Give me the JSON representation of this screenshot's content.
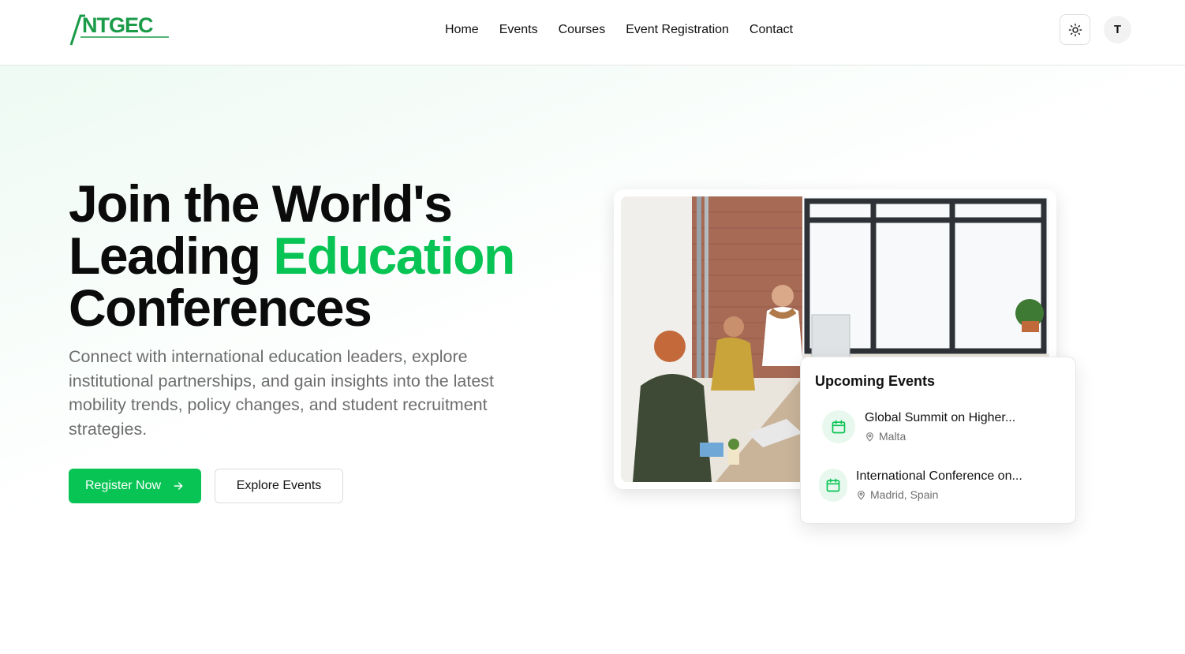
{
  "brand": {
    "logo_text": "ANTGEC",
    "accent_color": "#08c454"
  },
  "nav": {
    "items": [
      "Home",
      "Events",
      "Courses",
      "Event Registration",
      "Contact"
    ]
  },
  "header": {
    "theme_icon": "sun-icon",
    "avatar_initial": "T"
  },
  "hero": {
    "headline_line1": "Join the World's",
    "headline_line2_plain": "Leading ",
    "headline_line2_accent": "Education",
    "headline_line3": "Conferences",
    "subtitle": "Connect with international education leaders, explore institutional partnerships, and gain insights into the latest mobility trends, policy changes, and student recruitment strategies.",
    "primary_button": "Register Now",
    "primary_button_icon": "arrow-right-icon",
    "secondary_button": "Explore Events"
  },
  "upcoming": {
    "title": "Upcoming Events",
    "events": [
      {
        "name": "Global Summit on Higher...",
        "location": "Malta",
        "icon": "calendar-icon"
      },
      {
        "name": "International Conference on...",
        "location": "Madrid, Spain",
        "icon": "calendar-icon"
      }
    ]
  }
}
